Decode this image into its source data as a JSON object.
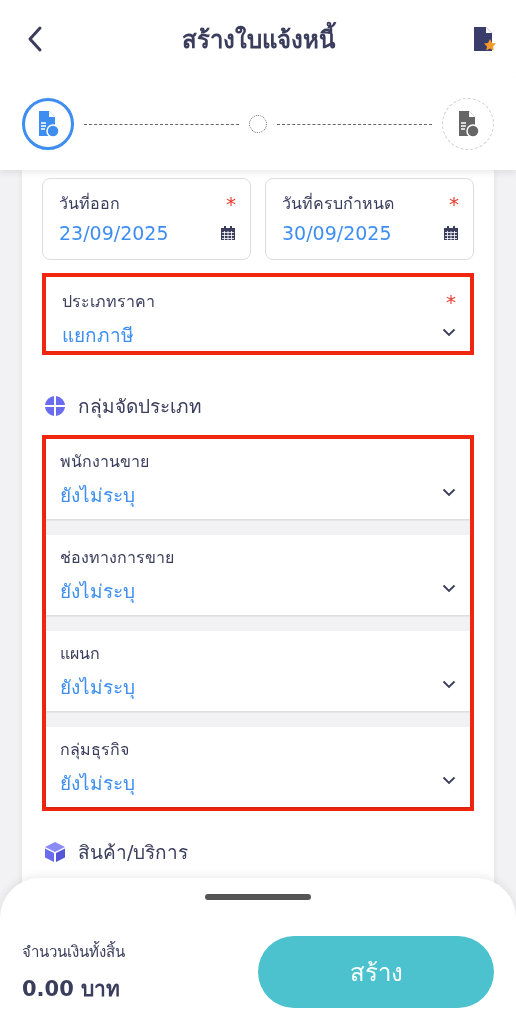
{
  "header": {
    "title": "สร้างใบแจ้งหนี้"
  },
  "steps": [
    {
      "kind": "invoice",
      "selected": true
    },
    {
      "kind": "dot",
      "selected": false
    },
    {
      "kind": "receipt",
      "selected": false
    }
  ],
  "dates": [
    {
      "label": "วันที่ออก",
      "value": "23/09/2025",
      "required_mark": "*"
    },
    {
      "label": "วันที่ครบกำหนด",
      "value": "30/09/2025",
      "required_mark": "*"
    }
  ],
  "price_type": {
    "label": "ประเภทราคา",
    "value": "แยกภาษี",
    "required_mark": "*",
    "highlighted": true
  },
  "classification": {
    "title": "กลุ่มจัดประเภท",
    "highlighted": true,
    "fields": [
      {
        "label": "พนักงานขาย",
        "value": "ยังไม่ระบุ"
      },
      {
        "label": "ช่องทางการขาย",
        "value": "ยังไม่ระบุ"
      },
      {
        "label": "แผนก",
        "value": "ยังไม่ระบุ"
      },
      {
        "label": "กลุ่มธุรกิจ",
        "value": "ยังไม่ระบุ"
      }
    ]
  },
  "products": {
    "title": "สินค้า/บริการ"
  },
  "footer": {
    "total_label": "จำนวนเงินทั้งสิ้น",
    "total": "0.00 บาท",
    "button": "สร้าง"
  }
}
